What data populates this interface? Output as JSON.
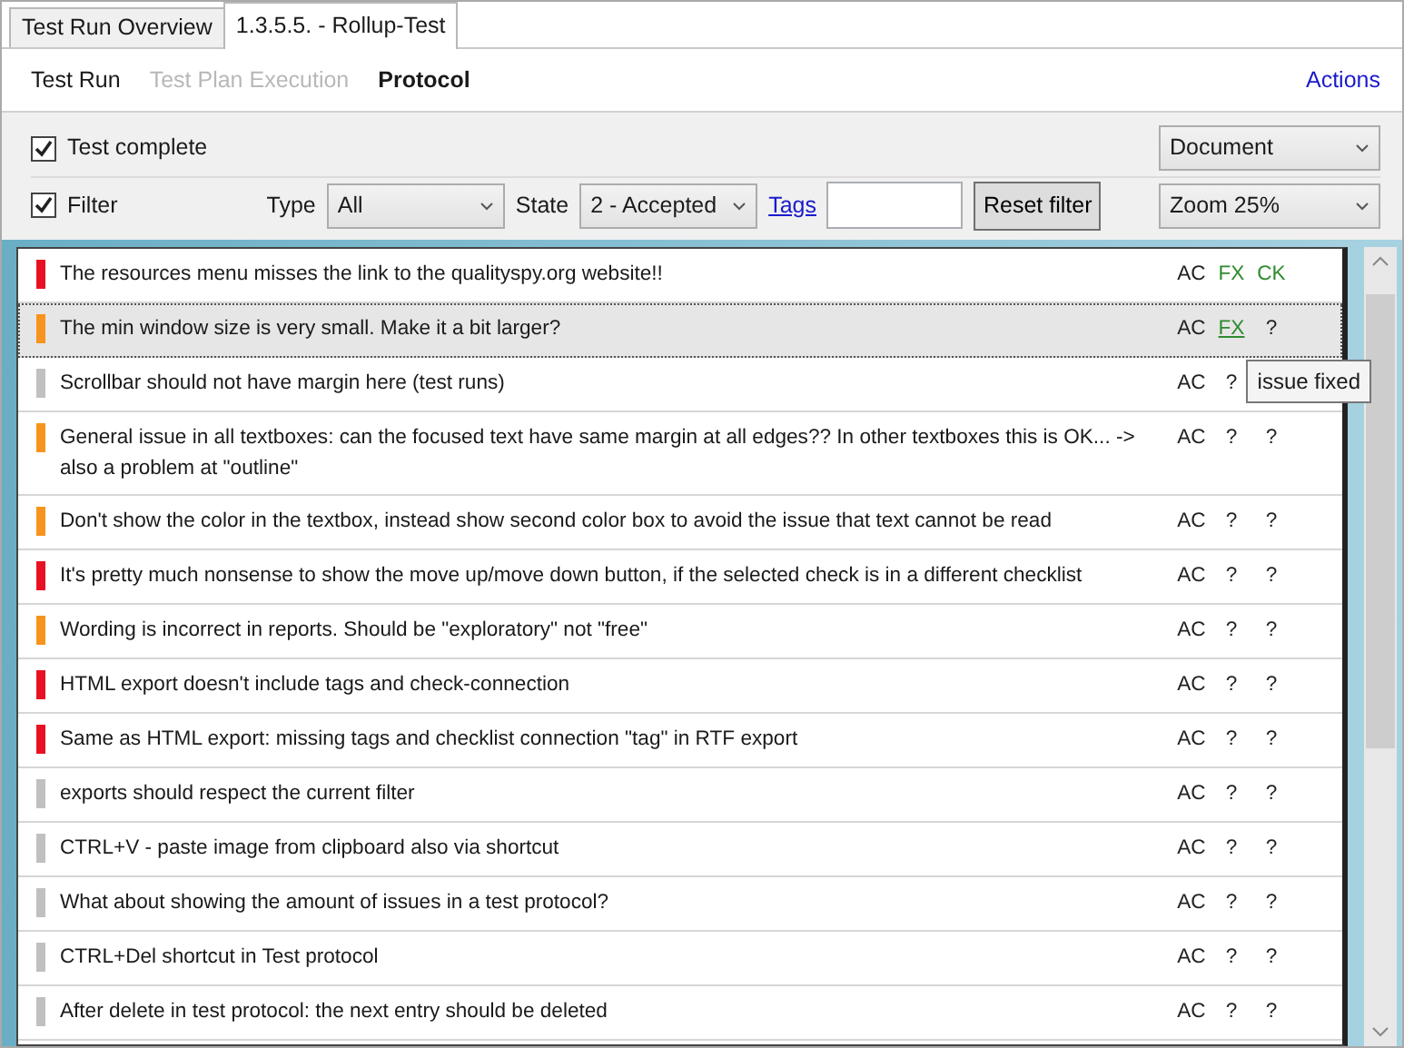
{
  "tabs": [
    {
      "label": "Test Run Overview",
      "selected": false
    },
    {
      "label": "1.3.5.5. - Rollup-Test",
      "selected": true
    }
  ],
  "nav": {
    "items": [
      {
        "label": "Test Run",
        "selected": false,
        "disabled": false
      },
      {
        "label": "Test Plan Execution",
        "selected": false,
        "disabled": true
      },
      {
        "label": "Protocol",
        "selected": true,
        "disabled": false
      }
    ],
    "actions": "Actions"
  },
  "toolbar": {
    "test_complete": {
      "label": "Test complete",
      "checked": true
    },
    "filter": {
      "label": "Filter",
      "checked": true
    },
    "type": {
      "label": "Type",
      "value": "All"
    },
    "state": {
      "label": "State",
      "value": "2 - Accepted"
    },
    "tags": {
      "label": "Tags"
    },
    "reset_button": "Reset filter",
    "view": {
      "value": "Document"
    },
    "zoom": {
      "value": "Zoom 25%"
    }
  },
  "issues": [
    {
      "text": "The resources menu misses the link to the qualityspy.org website!!",
      "color": "#e81123",
      "selected": false,
      "marks": [
        {
          "text": "AC",
          "color": "#222222",
          "hovered": false
        },
        {
          "text": "FX",
          "color": "#2e8b2e",
          "hovered": false
        },
        {
          "text": "CK",
          "color": "#2e8b2e",
          "hovered": false
        }
      ]
    },
    {
      "text": "The min window size is very small. Make it a bit larger?",
      "color": "#f7941d",
      "selected": true,
      "marks": [
        {
          "text": "AC",
          "color": "#222222",
          "hovered": false
        },
        {
          "text": "FX",
          "color": "#2e8b2e",
          "hovered": true
        },
        {
          "text": "?",
          "color": "#222222",
          "hovered": false
        }
      ]
    },
    {
      "text": "Scrollbar should not have margin here (test runs)",
      "color": "#c0c0c0",
      "selected": false,
      "marks": [
        {
          "text": "AC",
          "color": "#222222",
          "hovered": false
        },
        {
          "text": "?",
          "color": "#222222",
          "hovered": false
        }
      ]
    },
    {
      "text": "General issue in all textboxes: can the focused text have same margin at all edges?? In other textboxes this is OK... -> also a problem at \"outline\"",
      "color": "#f7941d",
      "selected": false,
      "marks": [
        {
          "text": "AC",
          "color": "#222222",
          "hovered": false
        },
        {
          "text": "?",
          "color": "#222222",
          "hovered": false
        },
        {
          "text": "?",
          "color": "#222222",
          "hovered": false
        }
      ]
    },
    {
      "text": "Don't show the color in the textbox, instead show second color box to avoid the issue that text cannot be read",
      "color": "#f7941d",
      "selected": false,
      "marks": [
        {
          "text": "AC",
          "color": "#222222",
          "hovered": false
        },
        {
          "text": "?",
          "color": "#222222",
          "hovered": false
        },
        {
          "text": "?",
          "color": "#222222",
          "hovered": false
        }
      ]
    },
    {
      "text": "It's pretty much nonsense to show the move up/move down button, if the selected check is in a different checklist",
      "color": "#e81123",
      "selected": false,
      "marks": [
        {
          "text": "AC",
          "color": "#222222",
          "hovered": false
        },
        {
          "text": "?",
          "color": "#222222",
          "hovered": false
        },
        {
          "text": "?",
          "color": "#222222",
          "hovered": false
        }
      ]
    },
    {
      "text": "Wording is incorrect in reports. Should be \"exploratory\" not \"free\"",
      "color": "#f7941d",
      "selected": false,
      "marks": [
        {
          "text": "AC",
          "color": "#222222",
          "hovered": false
        },
        {
          "text": "?",
          "color": "#222222",
          "hovered": false
        },
        {
          "text": "?",
          "color": "#222222",
          "hovered": false
        }
      ]
    },
    {
      "text": "HTML export doesn't include tags and check-connection",
      "color": "#e81123",
      "selected": false,
      "marks": [
        {
          "text": "AC",
          "color": "#222222",
          "hovered": false
        },
        {
          "text": "?",
          "color": "#222222",
          "hovered": false
        },
        {
          "text": "?",
          "color": "#222222",
          "hovered": false
        }
      ]
    },
    {
      "text": "Same as HTML export: missing tags and checklist connection \"tag\" in RTF export",
      "color": "#e81123",
      "selected": false,
      "marks": [
        {
          "text": "AC",
          "color": "#222222",
          "hovered": false
        },
        {
          "text": "?",
          "color": "#222222",
          "hovered": false
        },
        {
          "text": "?",
          "color": "#222222",
          "hovered": false
        }
      ]
    },
    {
      "text": "exports should respect the current filter",
      "color": "#c0c0c0",
      "selected": false,
      "marks": [
        {
          "text": "AC",
          "color": "#222222",
          "hovered": false
        },
        {
          "text": "?",
          "color": "#222222",
          "hovered": false
        },
        {
          "text": "?",
          "color": "#222222",
          "hovered": false
        }
      ]
    },
    {
      "text": "CTRL+V - paste image from clipboard also via shortcut",
      "color": "#c0c0c0",
      "selected": false,
      "marks": [
        {
          "text": "AC",
          "color": "#222222",
          "hovered": false
        },
        {
          "text": "?",
          "color": "#222222",
          "hovered": false
        },
        {
          "text": "?",
          "color": "#222222",
          "hovered": false
        }
      ]
    },
    {
      "text": "What about showing the amount of issues in a test protocol?",
      "color": "#c0c0c0",
      "selected": false,
      "marks": [
        {
          "text": "AC",
          "color": "#222222",
          "hovered": false
        },
        {
          "text": "?",
          "color": "#222222",
          "hovered": false
        },
        {
          "text": "?",
          "color": "#222222",
          "hovered": false
        }
      ]
    },
    {
      "text": "CTRL+Del shortcut in Test protocol",
      "color": "#c0c0c0",
      "selected": false,
      "marks": [
        {
          "text": "AC",
          "color": "#222222",
          "hovered": false
        },
        {
          "text": "?",
          "color": "#222222",
          "hovered": false
        },
        {
          "text": "?",
          "color": "#222222",
          "hovered": false
        }
      ]
    },
    {
      "text": "After delete in test protocol: the next entry should be deleted",
      "color": "#c0c0c0",
      "selected": false,
      "marks": [
        {
          "text": "AC",
          "color": "#222222",
          "hovered": false
        },
        {
          "text": "?",
          "color": "#222222",
          "hovered": false
        },
        {
          "text": "?",
          "color": "#222222",
          "hovered": false
        }
      ]
    }
  ],
  "tooltip": "issue fixed"
}
